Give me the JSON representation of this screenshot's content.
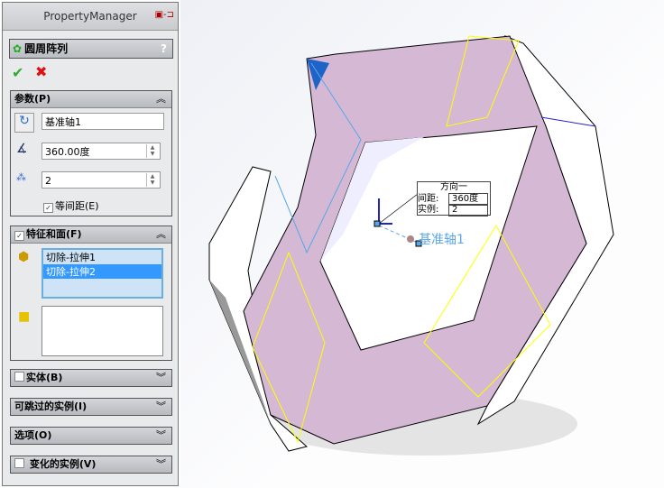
{
  "panel": {
    "title": "PropertyManager",
    "feature_title": "圆周阵列",
    "help": "?"
  },
  "params": {
    "header": "参数(P)",
    "axis": "基准轴1",
    "angle": "360.00度",
    "count": "2",
    "equal_spacing": "等间距(E)"
  },
  "features": {
    "header": "特征和面(F)",
    "items": [
      "切除-拉伸1",
      "切除-拉伸2"
    ],
    "selected": 1
  },
  "sections": {
    "bodies": "实体(B)",
    "skip": "可跳过的实例(I)",
    "options": "选项(O)",
    "vary": "变化的实例(V)"
  },
  "callout": {
    "title": "方向一",
    "spacing_label": "间距:",
    "spacing": "360度",
    "count_label": "实例:",
    "count": "2"
  },
  "axis_label": "基准轴1"
}
